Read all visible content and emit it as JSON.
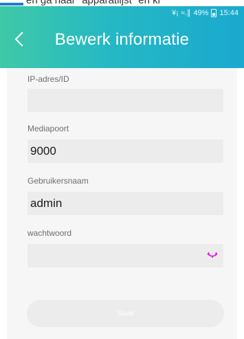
{
  "document_strip": {
    "text": "en ga naar \"apparatlijst\" en ki"
  },
  "status_bar": {
    "signal": "¥¡ ≈.∥",
    "battery": "49%",
    "time": "15:44"
  },
  "header": {
    "back_icon": "chevron-left-icon",
    "title": "Bewerk informatie"
  },
  "form": {
    "ip": {
      "label": "IP-adres/ID",
      "value": ""
    },
    "media_port": {
      "label": "Mediapoort",
      "value": "9000"
    },
    "username": {
      "label": "Gebruikersnaam",
      "value": "admin"
    },
    "password": {
      "label": "wachtwoord",
      "value": "",
      "eye_icon": "eye-closed-icon"
    },
    "save": {
      "label": "Save"
    }
  },
  "colors": {
    "header_start": "#3fc9a7",
    "header_end": "#1aa9cf",
    "eye_icon": "#e01ae0",
    "field_bg": "#ececec"
  }
}
